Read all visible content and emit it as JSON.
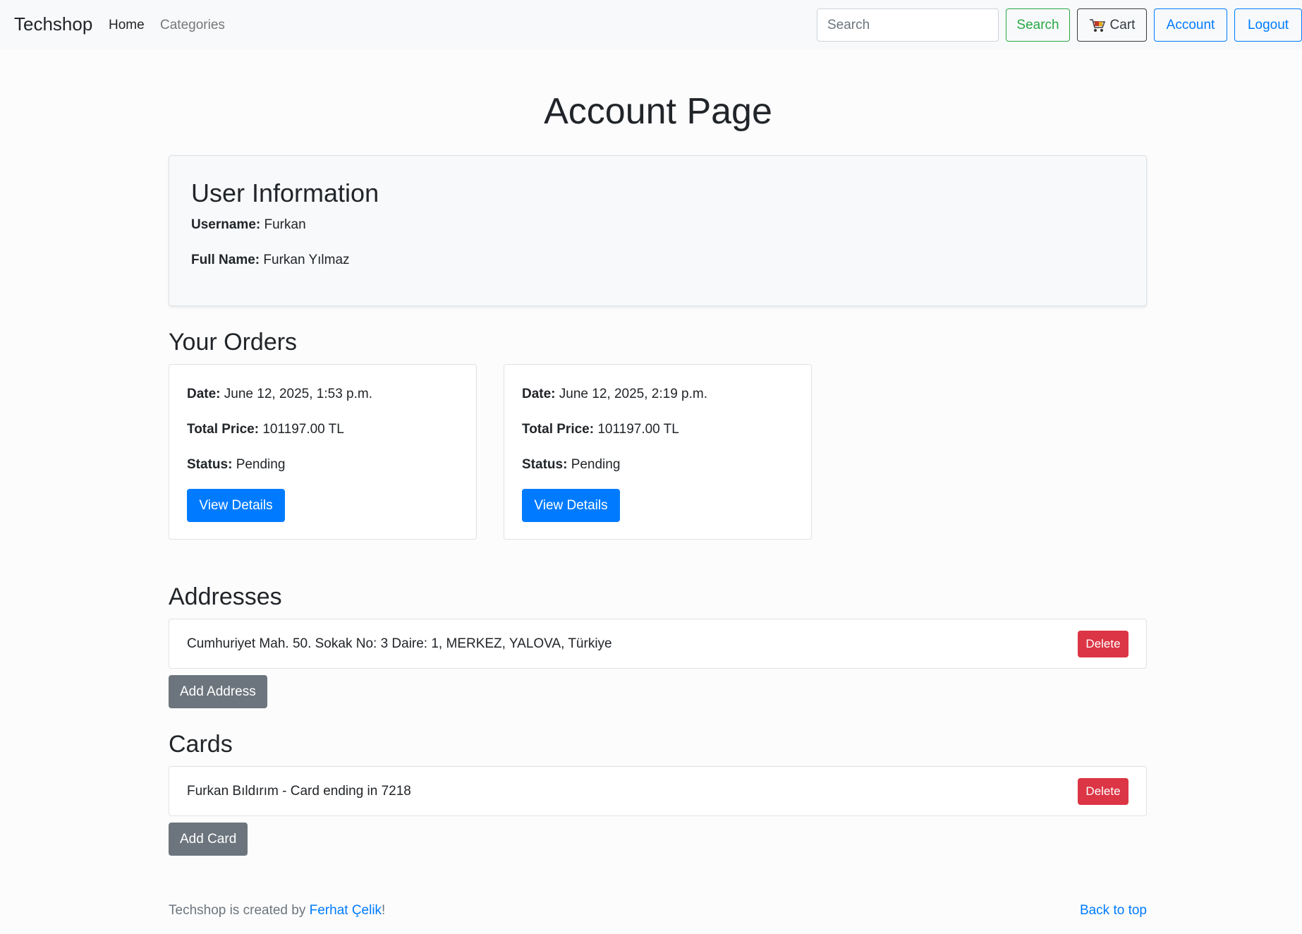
{
  "navbar": {
    "brand": "Techshop",
    "links": {
      "home": "Home",
      "categories": "Categories"
    },
    "search": {
      "placeholder": "Search",
      "button": "Search"
    },
    "cart": "Cart",
    "account": "Account",
    "logout": "Logout"
  },
  "page": {
    "title": "Account Page"
  },
  "user": {
    "heading": "User Information",
    "username_label": "Username:",
    "username": "Furkan",
    "fullname_label": "Full Name:",
    "fullname": "Furkan Yılmaz"
  },
  "orders": {
    "heading": "Your Orders",
    "date_label": "Date:",
    "total_label": "Total Price:",
    "status_label": "Status:",
    "button": "View Details",
    "items": [
      {
        "date": "June 12, 2025, 1:53 p.m.",
        "total": "101197.00 TL",
        "status": "Pending"
      },
      {
        "date": "June 12, 2025, 2:19 p.m.",
        "total": "101197.00 TL",
        "status": "Pending"
      }
    ]
  },
  "addresses": {
    "heading": "Addresses",
    "items": [
      {
        "text": "Cumhuriyet Mah. 50. Sokak No: 3 Daire: 1, MERKEZ, YALOVA, Türkiye",
        "delete": "Delete"
      }
    ],
    "add_button": "Add Address"
  },
  "cards": {
    "heading": "Cards",
    "items": [
      {
        "text": "Furkan Bıldırım - Card ending in 7218",
        "delete": "Delete"
      }
    ],
    "add_button": "Add Card"
  },
  "footer": {
    "prefix": "Techshop is created by ",
    "author": "Ferhat Çelik",
    "suffix": "!",
    "back_to_top": "Back to top"
  },
  "colors": {
    "primary": "#007bff",
    "success": "#28a745",
    "danger": "#dc3545",
    "secondary": "#6c757d"
  }
}
